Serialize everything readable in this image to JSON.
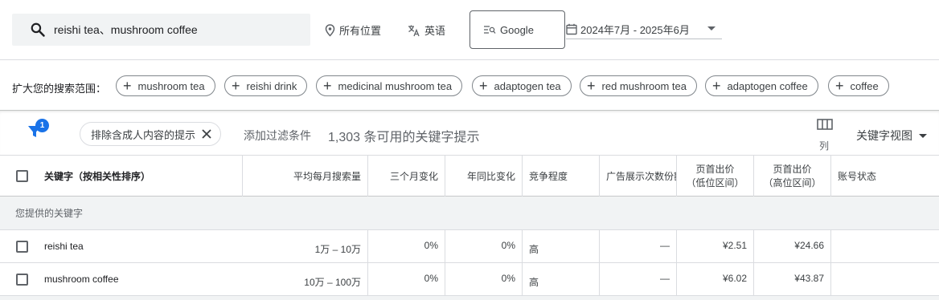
{
  "search": {
    "query": "reishi tea、mushroom coffee"
  },
  "location": {
    "label": "所有位置"
  },
  "language": {
    "label": "英语"
  },
  "engine": {
    "label": "Google"
  },
  "date_range": {
    "label": "2024年7月 - 2025年6月"
  },
  "broaden": {
    "label": "扩大您的搜索范围：",
    "chips": [
      "mushroom tea",
      "reishi drink",
      "medicinal mushroom tea",
      "adaptogen tea",
      "red mushroom tea",
      "adaptogen coffee",
      "coffee"
    ]
  },
  "filters": {
    "badge_count": "1",
    "active_filter": "排除含成人内容的提示",
    "add_filter": "添加过滤条件",
    "available_count": "1,303 条可用的关键字提示",
    "columns_label": "列",
    "view_label": "关键字视图"
  },
  "table": {
    "headers": {
      "keyword": "关键字（按相关性排序）",
      "avg_searches": "平均每月搜索量",
      "three_month": "三个月变化",
      "yoy": "年同比变化",
      "competition": "竞争程度",
      "impression_share": "广告展示次数份额",
      "bid_low_1": "页首出价",
      "bid_low_2": "（低位区间）",
      "bid_high_1": "页首出价",
      "bid_high_2": "（高位区间）",
      "account_status": "账号状态"
    },
    "section_label": "您提供的关键字",
    "rows": [
      {
        "keyword": "reishi tea",
        "avg_searches": "1万 – 10万",
        "three_month": "0%",
        "yoy": "0%",
        "competition": "高",
        "impression_share": "—",
        "bid_low": "¥2.51",
        "bid_high": "¥24.66",
        "account_status": ""
      },
      {
        "keyword": "mushroom coffee",
        "avg_searches": "10万 – 100万",
        "three_month": "0%",
        "yoy": "0%",
        "competition": "高",
        "impression_share": "—",
        "bid_low": "¥6.02",
        "bid_high": "¥43.87",
        "account_status": ""
      }
    ]
  },
  "colors": {
    "accent": "#1a73e8",
    "header_bg": "#f1f3f4",
    "border": "#dadce0"
  }
}
